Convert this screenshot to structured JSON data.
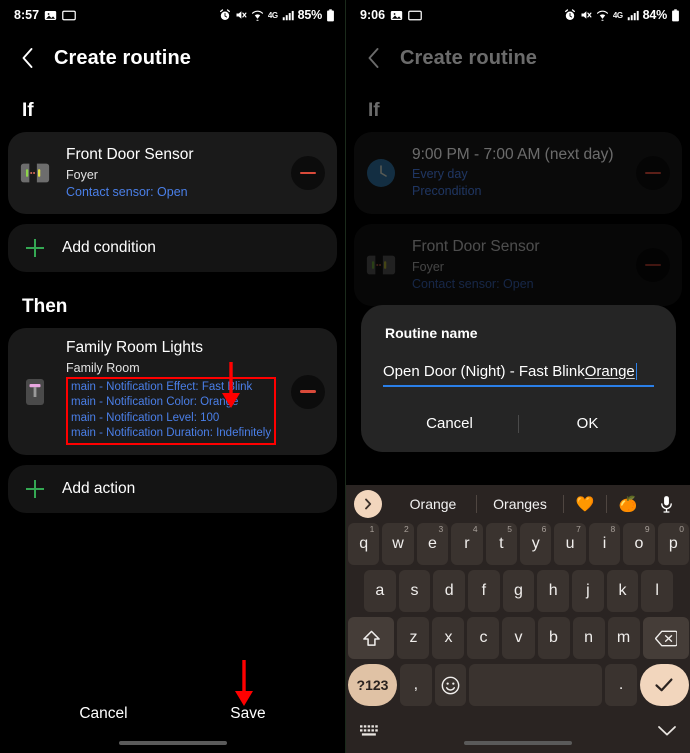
{
  "left": {
    "status": {
      "time": "8:57",
      "network": "4G",
      "battery": "85%",
      "icons": [
        "gallery-icon",
        "screen-cast-icon",
        "alarm-icon",
        "mute-icon",
        "wifi-icon",
        "signal-icon",
        "battery-icon"
      ]
    },
    "header": {
      "title": "Create routine",
      "back": "back-arrow-icon"
    },
    "if": {
      "label": "If",
      "cards": [
        {
          "name": "Front Door Sensor",
          "room": "Foyer",
          "state": "Contact sensor: Open",
          "icon": "contact-sensor-icon"
        }
      ],
      "add_label": "Add condition"
    },
    "then": {
      "label": "Then",
      "cards": [
        {
          "name": "Family Room Lights",
          "room": "Family Room",
          "icon": "light-strip-icon",
          "attributes": [
            "main - Notification Effect: Fast Blink",
            "main - Notification Color: Orange",
            "main - Notification Level: 100",
            "main - Notification Duration: Indefinitely"
          ]
        }
      ],
      "add_label": "Add action"
    },
    "bottom": {
      "cancel": "Cancel",
      "save": "Save"
    }
  },
  "right": {
    "status": {
      "time": "9:06",
      "network": "4G",
      "battery": "84%"
    },
    "header": {
      "title": "Create routine",
      "back": "back-arrow-icon"
    },
    "if": {
      "label": "If",
      "cards": [
        {
          "name": "9:00 PM - 7:00 AM (next day)",
          "room": "Every day",
          "state": "Precondition",
          "icon": "clock-icon"
        },
        {
          "name": "Front Door Sensor",
          "room": "Foyer",
          "state": "Contact sensor: Open",
          "icon": "contact-sensor-icon"
        }
      ]
    },
    "dialog": {
      "title": "Routine name",
      "value_plain": "Open Door (Night) - Fast Blink ",
      "value_spellchecked": "Orange",
      "cancel": "Cancel",
      "ok": "OK"
    },
    "keyboard": {
      "suggestions": [
        "Orange",
        "Oranges"
      ],
      "emoji": [
        "🧡",
        "🍊"
      ],
      "mic": "microphone-icon",
      "expand": "expand-suggestions-icon",
      "row1": [
        {
          "k": "q",
          "n": "1"
        },
        {
          "k": "w",
          "n": "2"
        },
        {
          "k": "e",
          "n": "3"
        },
        {
          "k": "r",
          "n": "4"
        },
        {
          "k": "t",
          "n": "5"
        },
        {
          "k": "y",
          "n": "6"
        },
        {
          "k": "u",
          "n": "7"
        },
        {
          "k": "i",
          "n": "8"
        },
        {
          "k": "o",
          "n": "9"
        },
        {
          "k": "p",
          "n": "0"
        }
      ],
      "row2": [
        "a",
        "s",
        "d",
        "f",
        "g",
        "h",
        "j",
        "k",
        "l"
      ],
      "row3": [
        "z",
        "x",
        "c",
        "v",
        "b",
        "n",
        "m"
      ],
      "shift": "shift-icon",
      "backspace": "backspace-icon",
      "sym": "?123",
      "comma": ",",
      "emoji_key": "emoji-icon",
      "space": "",
      "period": ".",
      "enter": "checkmark-icon",
      "kb_switch": "keyboard-switch-icon",
      "hide": "chevron-down-icon"
    }
  },
  "annotations": {
    "arrow_color": "#ff0000",
    "box_color": "#ff0000"
  },
  "colors": {
    "link_blue": "#4a7fe8",
    "accent_green": "#34a853",
    "remove_red": "#d94a3a",
    "input_underline": "#2a7fe8",
    "key_accent": "#f2d6bd"
  }
}
